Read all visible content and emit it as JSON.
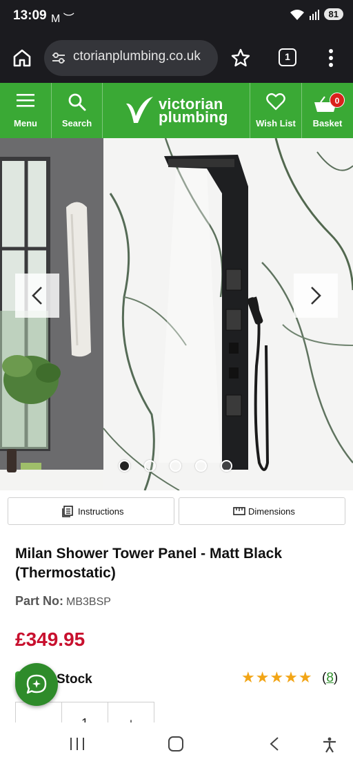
{
  "status_bar": {
    "time": "13:09",
    "notif": "M ︶",
    "battery": "81"
  },
  "browser": {
    "url": "ctorianplumbing.co.uk",
    "tab_count": "1"
  },
  "site_header": {
    "menu_label": "Menu",
    "search_label": "Search",
    "logo_line1": "victorian",
    "logo_line2": "plumbing",
    "wishlist_label": "Wish List",
    "basket_label": "Basket",
    "basket_count": "0",
    "brand_color": "#3aa935"
  },
  "gallery": {
    "slide_count": 5,
    "active_index": 0
  },
  "buttons": {
    "instructions_label": "Instructions",
    "dimensions_label": "Dimensions"
  },
  "product": {
    "title": "Milan Shower Tower Panel - Matt Black (Thermostatic)",
    "part_label": "Part No:",
    "part_value": "MB3BSP",
    "price": "£349.95",
    "stock_text": "Stock",
    "rating_stars": 5,
    "stars_glyph": "★★★★★",
    "review_open": "(",
    "review_count": "8",
    "review_close": ")",
    "quantity": "1",
    "qty_minus": "–",
    "qty_plus": "+"
  }
}
